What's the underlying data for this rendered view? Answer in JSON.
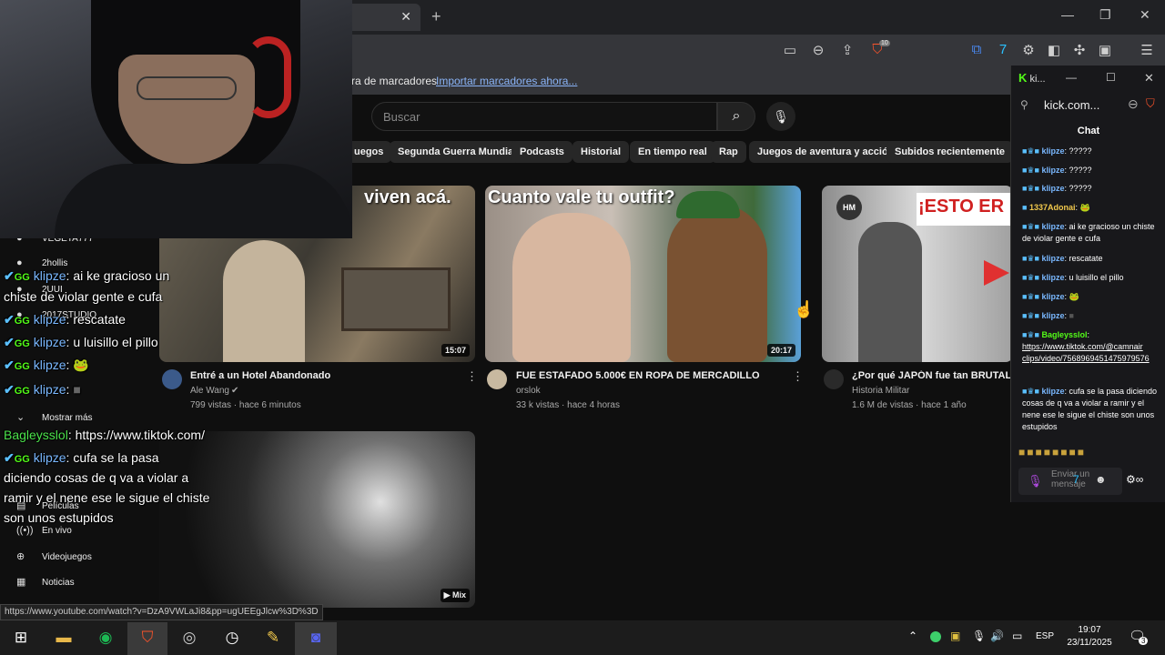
{
  "browser": {
    "bookmarks_text": "ra de marcadores",
    "bookmarks_link": "Importar marcadores ahora...",
    "brave_badge": "10"
  },
  "youtube": {
    "search_placeholder": "Buscar",
    "chips": [
      "uegos",
      "Segunda Guerra Mundial",
      "Podcasts",
      "Historial",
      "En tiempo real",
      "Rap",
      "Juegos de aventura y acción",
      "Subidos recientemente"
    ],
    "videos": [
      {
        "thumb_text": "viven acá.",
        "duration": "15:07",
        "title": "Entré a un Hotel Abandonado",
        "channel": "Ale Wang",
        "meta": "799 vistas · hace 6 minutos"
      },
      {
        "thumb_text": "Cuanto vale tu outfit?",
        "duration": "20:17",
        "title": "FUE ESTAFADO 5.000€ EN ROPA DE MERCADILLO",
        "channel": "orslok",
        "meta": "33 k vistas · hace 4 horas"
      },
      {
        "thumb_text": "¡ESTO ER",
        "thumb_badge": "HM",
        "title": "¿Por qué JAPÓN fue tan BRUTAL e",
        "channel": "Historia Militar",
        "meta": "1.6 M de vistas · hace 1 año"
      },
      {
        "duration": "Mix"
      }
    ],
    "sidebar": [
      {
        "label": "VEGETA777",
        "icon": "avatar"
      },
      {
        "label": "2hollis",
        "icon": "avatar"
      },
      {
        "label": "2UUI",
        "icon": "avatar"
      },
      {
        "label": "2017STUDIO",
        "icon": "avatar"
      },
      {
        "label": "Mostrar más",
        "icon": "chevron"
      },
      {
        "label": "Películas",
        "icon": "film"
      },
      {
        "label": "En vivo",
        "icon": "live"
      },
      {
        "label": "Videojuegos",
        "icon": "game"
      },
      {
        "label": "Noticias",
        "icon": "news"
      }
    ]
  },
  "overlay_chat": [
    {
      "user": "klipze",
      "text": "ai ke gracioso un"
    },
    {
      "user": "",
      "text": "chiste de violar gente e cufa"
    },
    {
      "user": "klipze",
      "text": "rescatate"
    },
    {
      "user": "klipze",
      "text": "u luisillo el pillo"
    },
    {
      "user": "klipze",
      "text": ""
    },
    {
      "user": "klipze",
      "text": ""
    },
    {
      "user": "Bagleysslol",
      "text": "https://www.tiktok.com/"
    },
    {
      "user": "klipze",
      "text": "cufa se la pasa"
    },
    {
      "user": "",
      "text": "diciendo cosas de q va a violar a"
    },
    {
      "user": "",
      "text": "ramir y el nene ese le sigue el chiste"
    },
    {
      "user": "",
      "text": "son unos estupidos"
    }
  ],
  "status_url": "https://www.youtube.com/watch?v=DzA9VWLaJi8&pp=ugUEEgJlcw%3D%3D",
  "kick": {
    "window_title": "ki...",
    "url": "kick.com...",
    "chat_header": "Chat",
    "messages": [
      {
        "user": "klipze",
        "text": "?????"
      },
      {
        "user": "klipze",
        "text": "?????"
      },
      {
        "user": "klipze",
        "text": "?????"
      },
      {
        "user": "1337Adonai",
        "text": ""
      },
      {
        "user": "klipze",
        "text": "ai ke gracioso un chiste de violar gente e cufa"
      },
      {
        "user": "klipze",
        "text": "rescatate"
      },
      {
        "user": "klipze",
        "text": "u luisillo el pillo"
      },
      {
        "user": "klipze",
        "text": ""
      },
      {
        "user": "klipze",
        "text": ""
      },
      {
        "user": "Bagleysslol",
        "text": "https://www.tiktok.com/@camnair clips/video/7568969451475979576"
      },
      {
        "user": "klipze",
        "text": "cufa se la pasa diciendo cosas de q va a violar a ramir y el nene ese le sigue el chiste son unos estupidos"
      }
    ],
    "input_placeholder": "Enviar un mensaje"
  },
  "taskbar": {
    "lang": "ESP",
    "time": "19:07",
    "date": "23/11/2025",
    "notif_count": "3"
  },
  "colors": {
    "kick_green": "#53fc18",
    "youtube_bg": "#0f0f0f",
    "brave_orange": "#fb542b"
  }
}
